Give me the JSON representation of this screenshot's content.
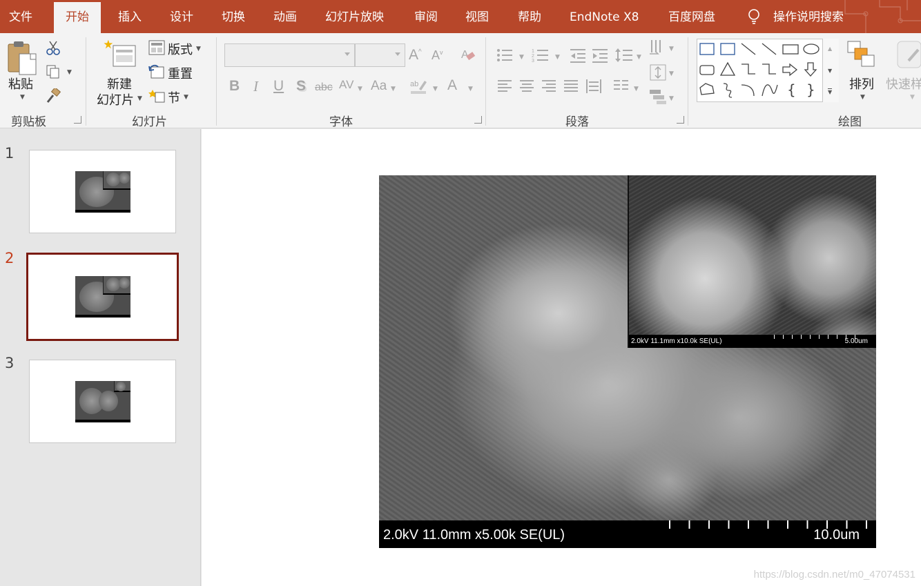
{
  "menu": {
    "tabs": [
      {
        "label": "文件"
      },
      {
        "label": "开始"
      },
      {
        "label": "插入"
      },
      {
        "label": "设计"
      },
      {
        "label": "切换"
      },
      {
        "label": "动画"
      },
      {
        "label": "幻灯片放映"
      },
      {
        "label": "审阅"
      },
      {
        "label": "视图"
      },
      {
        "label": "帮助"
      },
      {
        "label": "EndNote X8"
      },
      {
        "label": "百度网盘"
      }
    ],
    "active_tab": "开始",
    "tell_me": "操作说明搜索",
    "accent_color": "#b7472a"
  },
  "ribbon": {
    "clipboard": {
      "paste": "粘贴",
      "label": "剪贴板"
    },
    "slides": {
      "new_slide_line1": "新建",
      "new_slide_line2": "幻灯片",
      "layout": "版式",
      "reset": "重置",
      "section": "节",
      "label": "幻灯片"
    },
    "font": {
      "label": "字体",
      "font_name": "",
      "font_size": "",
      "bold": "B",
      "italic": "I",
      "underline": "U",
      "shadow": "S",
      "strike": "abc",
      "spacing": "AV",
      "case": "Aa",
      "color": "A"
    },
    "paragraph": {
      "label": "段落"
    },
    "drawing": {
      "arrange": "排列",
      "quick_styles": "快速样",
      "label": "绘图"
    }
  },
  "thumbnails": [
    {
      "number": "1"
    },
    {
      "number": "2"
    },
    {
      "number": "3"
    }
  ],
  "active_slide": "2",
  "slide": {
    "main_caption": "2.0kV 11.0mm x5.00k SE(UL)",
    "main_scale": "10.0um",
    "inset_caption": "2.0kV 11.1mm x10.0k SE(UL)",
    "inset_scale": "5.00um"
  },
  "watermark": "https://blog.csdn.net/m0_47074531"
}
